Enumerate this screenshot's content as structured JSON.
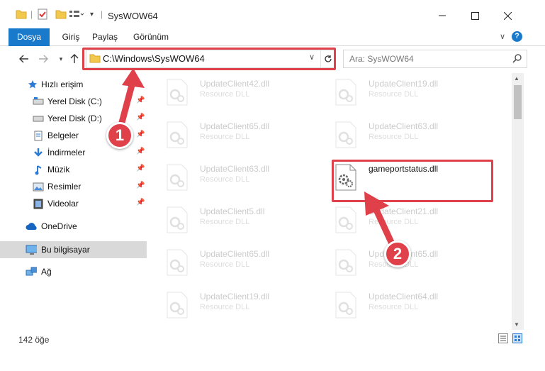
{
  "window": {
    "title": "SysWOW64",
    "controls": {
      "minimize": "minimize-icon",
      "maximize": "maximize-icon",
      "close": "close-icon"
    }
  },
  "ribbon": {
    "tabs": [
      "Dosya",
      "Giriş",
      "Paylaş",
      "Görünüm"
    ]
  },
  "address": {
    "path": "C:\\Windows\\SysWOW64"
  },
  "search": {
    "placeholder": "Ara: SysWOW64"
  },
  "sidebar": {
    "items": [
      {
        "label": "Hızlı erişim",
        "icon": "star-icon"
      },
      {
        "label": "Yerel Disk (C:)",
        "icon": "drive-icon",
        "pinned": true
      },
      {
        "label": "Yerel Disk (D:)",
        "icon": "drive-icon",
        "pinned": true
      },
      {
        "label": "Belgeler",
        "icon": "documents-icon",
        "pinned": true
      },
      {
        "label": "İndirmeler",
        "icon": "download-icon",
        "pinned": true
      },
      {
        "label": "Müzik",
        "icon": "music-icon",
        "pinned": true
      },
      {
        "label": "Resimler",
        "icon": "pictures-icon",
        "pinned": true
      },
      {
        "label": "Videolar",
        "icon": "videos-icon",
        "pinned": true
      },
      {
        "label": "OneDrive",
        "icon": "cloud-icon"
      },
      {
        "label": "Bu bilgisayar",
        "icon": "computer-icon",
        "selected": true
      },
      {
        "label": "Ağ",
        "icon": "network-icon"
      }
    ]
  },
  "files": {
    "left": [
      {
        "name": "UpdateClient42.dll",
        "desc": "Resource DLL"
      },
      {
        "name": "UpdateClient65.dll",
        "desc": "Resource DLL"
      },
      {
        "name": "UpdateClient63.dll",
        "desc": "Resource DLL"
      },
      {
        "name": "UpdateClient5.dll",
        "desc": "Resource DLL"
      },
      {
        "name": "UpdateClient65.dll",
        "desc": "Resource DLL"
      },
      {
        "name": "UpdateClient19.dll",
        "desc": "Resource DLL"
      }
    ],
    "right": [
      {
        "name": "UpdateClient19.dll",
        "desc": "Resource DLL"
      },
      {
        "name": "UpdateClient63.dll",
        "desc": "Resource DLL"
      },
      {
        "name": "gameportstatus.dll",
        "desc": ""
      },
      {
        "name": "UpdateClient21.dll",
        "desc": "Resource DLL"
      },
      {
        "name": "UpdateClient65.dll",
        "desc": "Resource DLL"
      },
      {
        "name": "UpdateClient64.dll",
        "desc": "Resource DLL"
      }
    ]
  },
  "status": {
    "item_count": "142 öğe"
  },
  "annotations": {
    "step1": "1",
    "step2": "2",
    "color": "#e0404a"
  }
}
